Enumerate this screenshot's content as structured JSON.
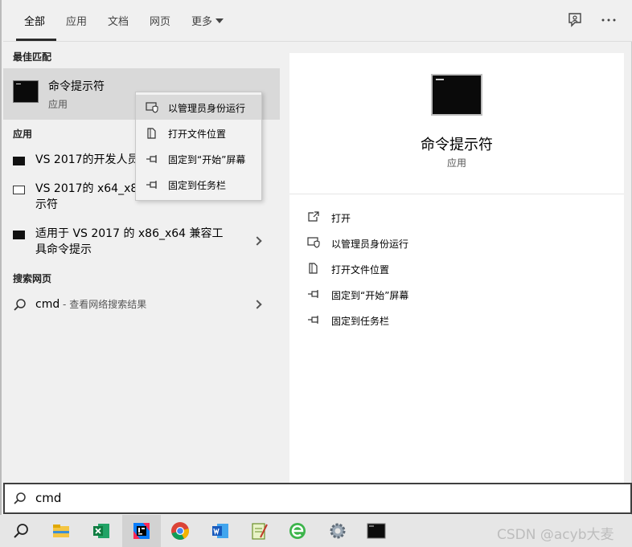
{
  "tabs": [
    {
      "label": "全部"
    },
    {
      "label": "应用"
    },
    {
      "label": "文档"
    },
    {
      "label": "网页"
    },
    {
      "label": "更多"
    }
  ],
  "sections": {
    "best_match": "最佳匹配",
    "apps": "应用",
    "web": "搜索网页"
  },
  "best_match": {
    "title": "命令提示符",
    "subtitle": "应用"
  },
  "apps": [
    {
      "label": "VS 2017的开发人员"
    },
    {
      "line1": "VS 2017的 x64_x8",
      "line2": "示符"
    },
    {
      "line1": "适用于 VS 2017 的 x86_x64 兼容工",
      "line2": "具命令提示"
    }
  ],
  "web": {
    "query": "cmd",
    "separator": " - ",
    "sub": "查看网络搜索结果"
  },
  "context_menu": [
    {
      "label": "以管理员身份运行",
      "icon": "shield-icon"
    },
    {
      "label": "打开文件位置",
      "icon": "file-location-icon"
    },
    {
      "label": "固定到“开始”屏幕",
      "icon": "pin-icon"
    },
    {
      "label": "固定到任务栏",
      "icon": "pin-icon"
    }
  ],
  "detail": {
    "title": "命令提示符",
    "subtitle": "应用",
    "actions": [
      {
        "label": "打开",
        "icon": "open-icon"
      },
      {
        "label": "以管理员身份运行",
        "icon": "shield-icon"
      },
      {
        "label": "打开文件位置",
        "icon": "file-location-icon"
      },
      {
        "label": "固定到“开始”屏幕",
        "icon": "pin-icon"
      },
      {
        "label": "固定到任务栏",
        "icon": "pin-icon"
      }
    ]
  },
  "search": {
    "value": "cmd"
  },
  "taskbar": {
    "apps": [
      "search-icon",
      "file-explorer-icon",
      "excel-icon",
      "intellij-icon",
      "chrome-icon",
      "word-icon",
      "notepad-icon",
      "browser-icon",
      "settings-gear-icon",
      "terminal-icon"
    ]
  },
  "watermark": "CSDN @acyb大麦"
}
